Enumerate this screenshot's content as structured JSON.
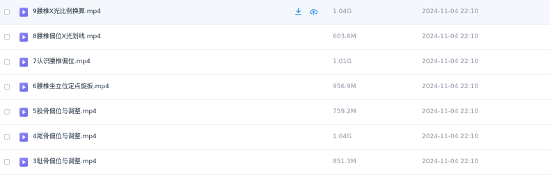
{
  "files": [
    {
      "name": "9腰椎X光比例换算.mp4",
      "size": "1.04G",
      "date": "2024-11-04 22:10",
      "hover": true
    },
    {
      "name": "8腰椎偏位X光划线.mp4",
      "size": "603.6M",
      "date": "2024-11-04 22:10",
      "hover": false
    },
    {
      "name": "7认识腰椎偏位.mp4",
      "size": "1.01G",
      "date": "2024-11-04 22:10",
      "hover": false
    },
    {
      "name": "6腰椎坐立位定点旋扳.mp4",
      "size": "956.9M",
      "date": "2024-11-04 22:10",
      "hover": false
    },
    {
      "name": "5股骨偏位与调整.mp4",
      "size": "759.2M",
      "date": "2024-11-04 22:10",
      "hover": false
    },
    {
      "name": "4尾骨偏位与调整.mp4",
      "size": "1.04G",
      "date": "2024-11-04 22:10",
      "hover": false
    },
    {
      "name": "3耻骨偏位与调整.mp4",
      "size": "851.3M",
      "date": "2024-11-04 22:10",
      "hover": false
    }
  ],
  "icons": {
    "file": "video-file-icon",
    "download": "download-icon",
    "cloud": "cloud-upload-icon"
  },
  "colors": {
    "accent": "#2f8fe8",
    "file_icon": "#7b76f0",
    "muted_text": "#8c95a3",
    "hover_row": "#f4f8fd"
  }
}
